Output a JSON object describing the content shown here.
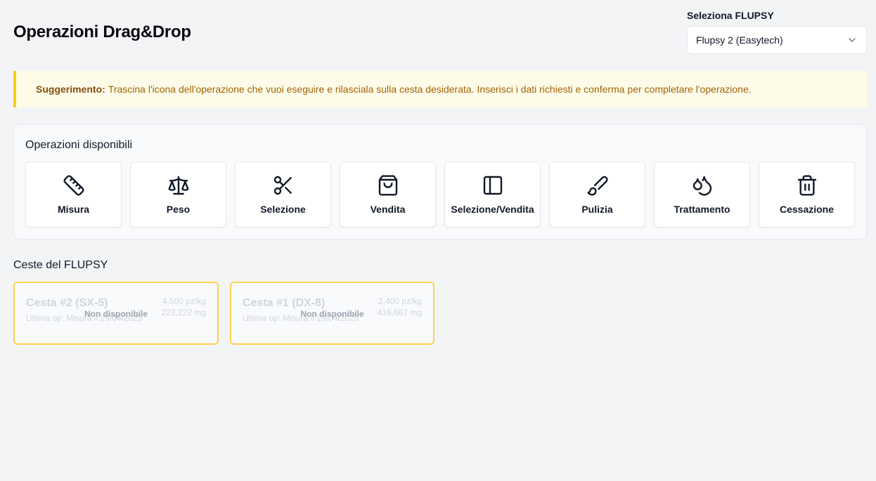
{
  "header": {
    "title": "Operazioni Drag&Drop",
    "select_label": "Seleziona FLUPSY",
    "select_value": "Flupsy 2 (Easytech)"
  },
  "tip": {
    "strong": "Suggerimento:",
    "text": "Trascina l'icona dell'operazione che vuoi eseguire e rilasciala sulla cesta desiderata. Inserisci i dati richiesti e conferma per completare l'operazione."
  },
  "operations": {
    "title": "Operazioni disponibili",
    "items": [
      {
        "label": "Misura",
        "icon": "ruler-icon"
      },
      {
        "label": "Peso",
        "icon": "scale-icon"
      },
      {
        "label": "Selezione",
        "icon": "scissors-icon"
      },
      {
        "label": "Vendita",
        "icon": "shopping-bag-icon"
      },
      {
        "label": "Selezione/Vendita",
        "icon": "panel-left-icon"
      },
      {
        "label": "Pulizia",
        "icon": "brush-icon"
      },
      {
        "label": "Trattamento",
        "icon": "droplets-icon"
      },
      {
        "label": "Cessazione",
        "icon": "trash-icon"
      }
    ]
  },
  "baskets": {
    "title": "Ceste del FLUPSY",
    "items": [
      {
        "name": "Cesta #2 (SX-5)",
        "last_op": "Ultima op: Misura il 29/04/2025",
        "stat1": "4,500 pz/kg",
        "stat2": "222,222 mg",
        "status": "Non disponibile"
      },
      {
        "name": "Cesta #1 (DX-8)",
        "last_op": "Ultima op: Misura il 29/04/2025",
        "stat1": "2,400 pz/kg",
        "stat2": "416,667 mg",
        "status": "Non disponibile"
      }
    ]
  },
  "colors": {
    "tip_bg": "#fefce8",
    "tip_border": "#facc15",
    "tip_text": "#a16207",
    "basket_border": "#fcd34d"
  }
}
